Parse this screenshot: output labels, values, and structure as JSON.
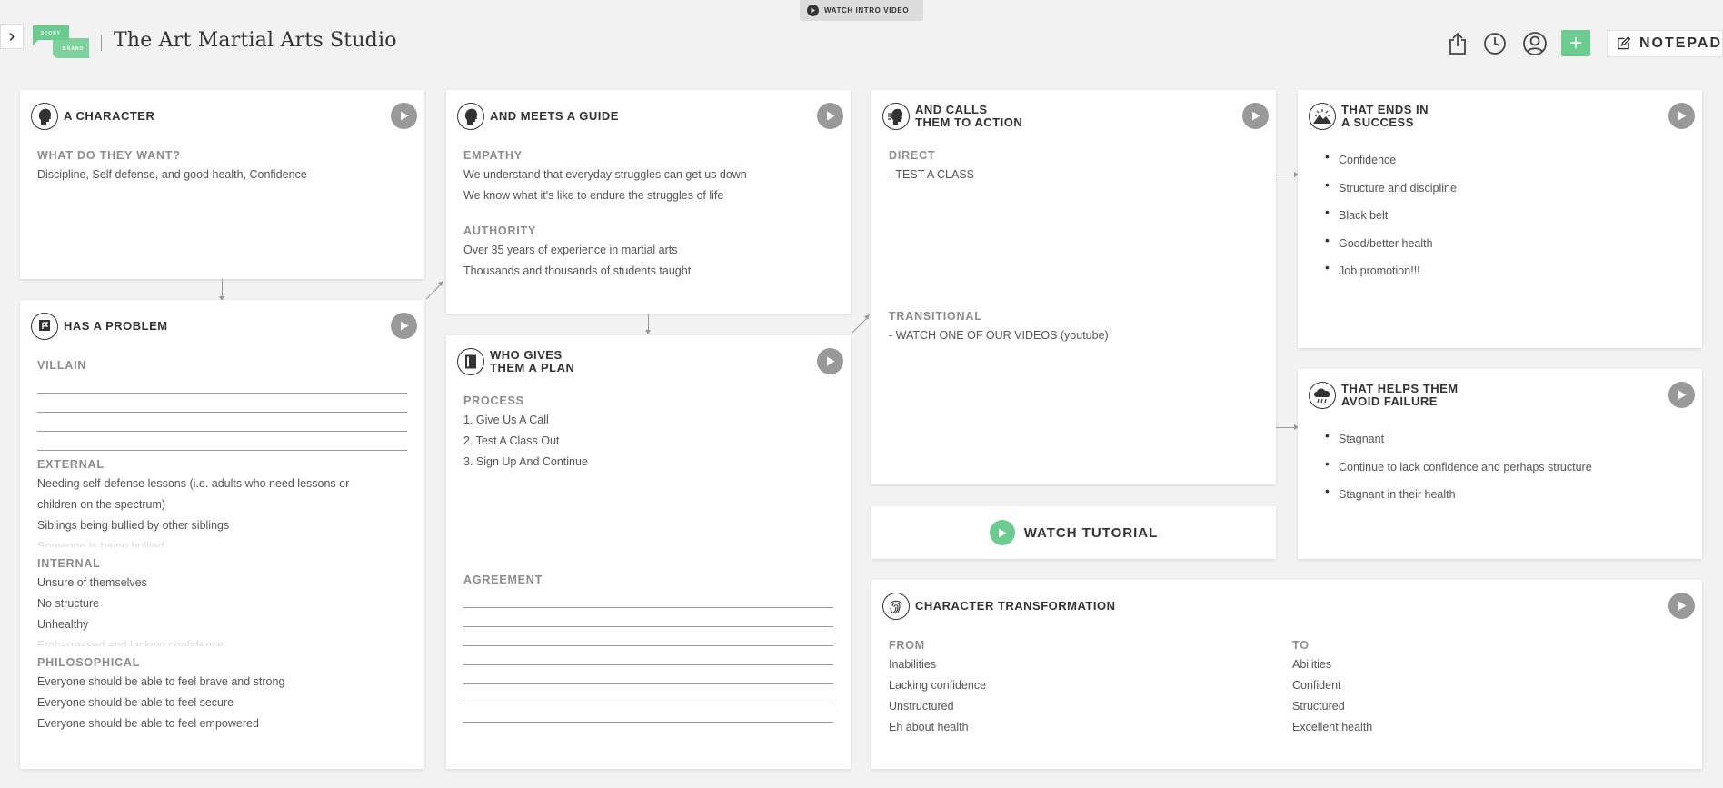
{
  "header": {
    "title": "The Art Martial Arts Studio",
    "intro_video_label": "WATCH INTRO VIDEO",
    "notepad_label": "NOTEPAD",
    "add_label": "+",
    "logo_top": "STORY",
    "logo_bottom": "BRAND",
    "accent_color": "#6ccb8f"
  },
  "character": {
    "title": "A CHARACTER",
    "icon": "person-head-icon",
    "want_label": "WHAT DO THEY WANT?",
    "want_text": "Discipline, Self defense, and good health, Confidence"
  },
  "problem": {
    "title": "HAS A PROBLEM",
    "icon": "flag-icon",
    "villain_label": "VILLAIN",
    "external_label": "EXTERNAL",
    "external": [
      "Needing self-defense lessons (i.e. adults who need lessons or",
      "children on the spectrum)",
      "Siblings being bullied by other siblings",
      "Someone is being bullied"
    ],
    "internal_label": "INTERNAL",
    "internal": [
      "Unsure of themselves",
      "No structure",
      "Unhealthy",
      "Embarrassed and lacking confidence"
    ],
    "philosophical_label": "PHILOSOPHICAL",
    "philosophical": [
      "Everyone should be able to feel brave and strong",
      "Everyone should be able to feel secure",
      "Everyone should be able to feel empowered"
    ]
  },
  "guide": {
    "title": "AND MEETS A GUIDE",
    "icon": "guide-head-icon",
    "empathy_label": "EMPATHY",
    "empathy": [
      "We understand that everyday struggles can get us down",
      "We know what it's like to endure the struggles of life"
    ],
    "authority_label": "AUTHORITY",
    "authority": [
      "Over 35 years of experience in martial arts",
      "Thousands and thousands of students taught"
    ]
  },
  "plan": {
    "title": "WHO GIVES\nTHEM A PLAN",
    "icon": "document-icon",
    "process_label": "PROCESS",
    "process": [
      "1. Give Us A Call",
      "2. Test A Class Out",
      "3. Sign Up And Continue"
    ],
    "agreement_label": "AGREEMENT"
  },
  "action": {
    "title": "AND CALLS\nTHEM TO ACTION",
    "icon": "calling-person-icon",
    "direct_label": "DIRECT",
    "direct": "- TEST A CLASS",
    "transitional_label": "TRANSITIONAL",
    "transitional": "- WATCH ONE OF OUR VIDEOS (youtube)"
  },
  "success": {
    "title": "THAT ENDS IN\nA SUCCESS",
    "icon": "sunrise-mountain-icon",
    "items": [
      "Confidence",
      "Structure and discipline",
      "Black belt",
      "Good/better health",
      "Job promotion!!!"
    ]
  },
  "failure": {
    "title": "THAT HELPS THEM\nAVOID FAILURE",
    "icon": "storm-cloud-icon",
    "items": [
      "Stagnant",
      "Continue to lack confidence and perhaps structure",
      "Stagnant in their health"
    ]
  },
  "tutorial": {
    "label": "WATCH TUTORIAL"
  },
  "transformation": {
    "title": "CHARACTER TRANSFORMATION",
    "icon": "fingerprint-icon",
    "from_label": "FROM",
    "from": [
      "Inabilities",
      "Lacking confidence",
      "Unstructured",
      "Eh about health"
    ],
    "to_label": "TO",
    "to": [
      "Abilities",
      "Confident",
      "Structured",
      "Excellent health"
    ]
  }
}
